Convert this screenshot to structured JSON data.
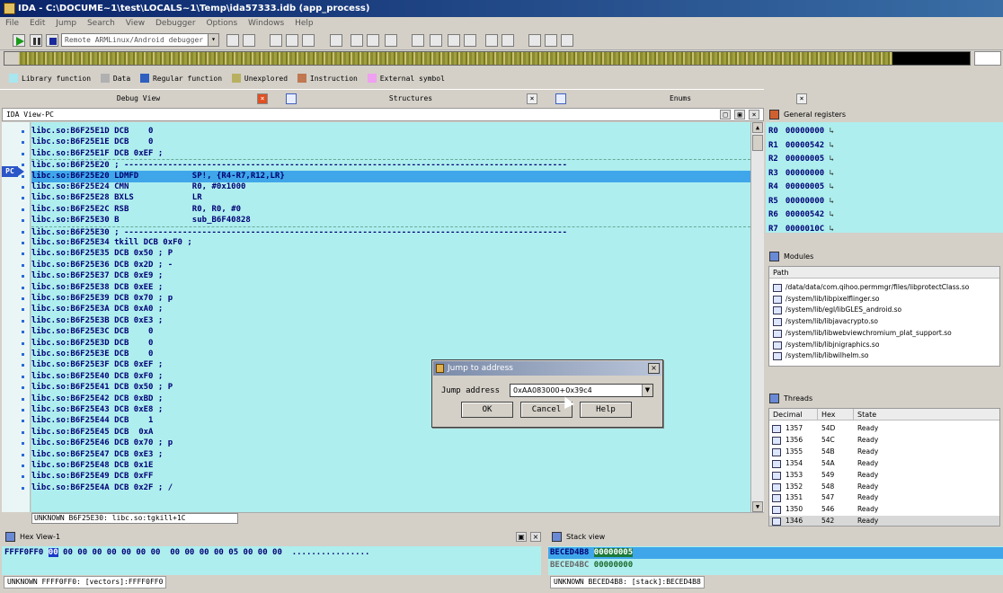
{
  "window": {
    "title": "IDA - C:\\DOCUME~1\\test\\LOCALS~1\\Temp\\ida57333.idb (app_process)"
  },
  "menu": [
    "File",
    "Edit",
    "Jump",
    "Search",
    "View",
    "Debugger",
    "Options",
    "Windows",
    "Help"
  ],
  "toolbar": {
    "debugger": "Remote ARMLinux/Android debugger"
  },
  "legend": [
    {
      "label": "Library function",
      "color": "#a8e6f0"
    },
    {
      "label": "Data",
      "color": "#b0b0b0"
    },
    {
      "label": "Regular function",
      "color": "#2f5fbf"
    },
    {
      "label": "Unexplored",
      "color": "#b8b060"
    },
    {
      "label": "Instruction",
      "color": "#c07850"
    },
    {
      "label": "External symbol",
      "color": "#f0a0f0"
    }
  ],
  "tabs": [
    "Debug View",
    "Structures",
    "Enums"
  ],
  "ida_view": {
    "title": "IDA View-PC",
    "pc_label": "PC",
    "lines": [
      {
        "text": "libc.so:B6F25E1D DCB    0",
        "cls": ""
      },
      {
        "text": "libc.so:B6F25E1E DCB    0",
        "cls": ""
      },
      {
        "text": "libc.so:B6F25E1F DCB 0xEF ;",
        "cls": ""
      },
      {
        "text": "libc.so:B6F25E20 ; -------------------------------------------------------------------------------------------",
        "cls": "sep"
      },
      {
        "text": "libc.so:B6F25E20 LDMFD           SP!, {R4-R7,R12,LR}",
        "cls": "hl"
      },
      {
        "text": "libc.so:B6F25E24 CMN             R0, #0x1000",
        "cls": ""
      },
      {
        "text": "libc.so:B6F25E28 BXLS            LR",
        "cls": ""
      },
      {
        "text": "libc.so:B6F25E2C RSB             R0, R0, #0",
        "cls": ""
      },
      {
        "text": "libc.so:B6F25E30 B               sub_B6F40828",
        "cls": ""
      },
      {
        "text": "libc.so:B6F25E30 ; -------------------------------------------------------------------------------------------",
        "cls": "sep"
      },
      {
        "text": "libc.so:B6F25E34 tkill DCB 0xF0 ;",
        "cls": ""
      },
      {
        "text": "libc.so:B6F25E35 DCB 0x50 ; P",
        "cls": ""
      },
      {
        "text": "libc.so:B6F25E36 DCB 0x2D ; -",
        "cls": ""
      },
      {
        "text": "libc.so:B6F25E37 DCB 0xE9 ;",
        "cls": ""
      },
      {
        "text": "libc.so:B6F25E38 DCB 0xEE ;",
        "cls": ""
      },
      {
        "text": "libc.so:B6F25E39 DCB 0x70 ; p",
        "cls": ""
      },
      {
        "text": "libc.so:B6F25E3A DCB 0xA0 ;",
        "cls": ""
      },
      {
        "text": "libc.so:B6F25E3B DCB 0xE3 ;",
        "cls": ""
      },
      {
        "text": "libc.so:B6F25E3C DCB    0",
        "cls": ""
      },
      {
        "text": "libc.so:B6F25E3D DCB    0",
        "cls": ""
      },
      {
        "text": "libc.so:B6F25E3E DCB    0",
        "cls": ""
      },
      {
        "text": "libc.so:B6F25E3F DCB 0xEF ;",
        "cls": ""
      },
      {
        "text": "libc.so:B6F25E40 DCB 0xF0 ;",
        "cls": ""
      },
      {
        "text": "libc.so:B6F25E41 DCB 0x50 ; P",
        "cls": ""
      },
      {
        "text": "libc.so:B6F25E42 DCB 0xBD ;",
        "cls": ""
      },
      {
        "text": "libc.so:B6F25E43 DCB 0xE8 ;",
        "cls": ""
      },
      {
        "text": "libc.so:B6F25E44 DCB    1",
        "cls": ""
      },
      {
        "text": "libc.so:B6F25E45 DCB  0xA",
        "cls": ""
      },
      {
        "text": "libc.so:B6F25E46 DCB 0x70 ; p",
        "cls": ""
      },
      {
        "text": "libc.so:B6F25E47 DCB 0xE3 ;",
        "cls": ""
      },
      {
        "text": "libc.so:B6F25E48 DCB 0x1E",
        "cls": ""
      },
      {
        "text": "libc.so:B6F25E49 DCB 0xFF",
        "cls": ""
      },
      {
        "text": "libc.so:B6F25E4A DCB 0x2F ; /",
        "cls": ""
      }
    ],
    "status": "UNKNOWN B6F25E30: libc.so:tgkill+1C"
  },
  "registers": {
    "title": "General registers",
    "rows": [
      {
        "name": "R0",
        "value": "00000000"
      },
      {
        "name": "R1",
        "value": "00000542"
      },
      {
        "name": "R2",
        "value": "00000005"
      },
      {
        "name": "R3",
        "value": "00000000"
      },
      {
        "name": "R4",
        "value": "00000005"
      },
      {
        "name": "R5",
        "value": "00000000"
      },
      {
        "name": "R6",
        "value": "00000542"
      },
      {
        "name": "R7",
        "value": "0000010C"
      }
    ]
  },
  "modules": {
    "title": "Modules",
    "column": "Path",
    "items": [
      "/data/data/com.qihoo.permmgr/files/libprotectClass.so",
      "/system/lib/libpixelflinger.so",
      "/system/lib/egl/libGLES_android.so",
      "/system/lib/libjavacrypto.so",
      "/system/lib/libwebviewchromium_plat_support.so",
      "/system/lib/libjnigraphics.so",
      "/system/lib/libwilhelm.so"
    ]
  },
  "threads": {
    "title": "Threads",
    "columns": [
      "Decimal",
      "Hex",
      "State"
    ],
    "rows": [
      {
        "dec": "1357",
        "hex": "54D",
        "state": "Ready"
      },
      {
        "dec": "1356",
        "hex": "54C",
        "state": "Ready"
      },
      {
        "dec": "1355",
        "hex": "54B",
        "state": "Ready"
      },
      {
        "dec": "1354",
        "hex": "54A",
        "state": "Ready"
      },
      {
        "dec": "1353",
        "hex": "549",
        "state": "Ready"
      },
      {
        "dec": "1352",
        "hex": "548",
        "state": "Ready"
      },
      {
        "dec": "1351",
        "hex": "547",
        "state": "Ready"
      },
      {
        "dec": "1350",
        "hex": "546",
        "state": "Ready"
      },
      {
        "dec": "1346",
        "hex": "542",
        "state": "Ready"
      }
    ]
  },
  "hex_view": {
    "title": "Hex View-1",
    "address": "FFFF0FF0",
    "first_byte": "00",
    "bytes": " 00 00 00 00 00 00 00  00 00 00 00 05 00 00 00",
    "ascii": "................",
    "status": "UNKNOWN FFFF0FF0: [vectors]:FFFF0FF0"
  },
  "stack_view": {
    "title": "Stack view",
    "rows": [
      {
        "addr": "BECED4B8",
        "value": "00000005"
      },
      {
        "addr": "BECED4BC",
        "value": "00000000"
      }
    ],
    "status": "UNKNOWN BECED4B8: [stack]:BECED4B8"
  },
  "dialog": {
    "title": "Jump to address",
    "label": "Jump address",
    "value": "0xAA083000+0x39c4",
    "ok": "OK",
    "cancel": "Cancel",
    "help": "Help"
  }
}
